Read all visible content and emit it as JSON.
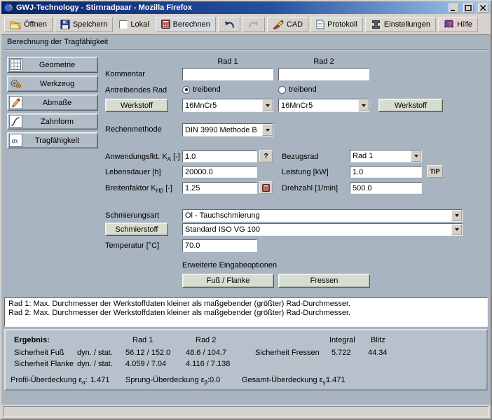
{
  "window": {
    "title": "GWJ-Technology - Stirnradpaar - Mozilla Firefox"
  },
  "toolbar": {
    "open": "Öffnen",
    "save": "Speichern",
    "local": "Lokal",
    "calculate": "Berechnen",
    "cad": "CAD",
    "protocol": "Protokoll",
    "settings": "Einstellungen",
    "help": "Hilfe"
  },
  "header": {
    "title": "Berechnung der Tragfähigkeit"
  },
  "sidebar": {
    "items": [
      {
        "label": "Geometrie"
      },
      {
        "label": "Werkzeug"
      },
      {
        "label": "Abmaße"
      },
      {
        "label": "Zahnform"
      },
      {
        "label": "Tragfähigkeit"
      }
    ]
  },
  "icons": {
    "sigma_glyph": "σx",
    "help_glyph": "?"
  },
  "form": {
    "col1_header": "Rad 1",
    "col2_header": "Rad 2",
    "comment_label": "Kommentar",
    "comment1": "",
    "comment2": "",
    "driving_label": "Antreibendes Rad",
    "radio1_label": "treibend",
    "radio2_label": "treibend",
    "material_button_left": "Werkstoff",
    "material_button_right": "Werkstoff",
    "material1": "16MnCr5",
    "material2": "16MnCr5",
    "method_label": "Rechenmethode",
    "method_value": "DIN 3990 Methode B",
    "ka_label": {
      "pre": "Anwendungsfkt. K",
      "sub": "A",
      "post": " [-]"
    },
    "ka_value": "1.0",
    "help_button": "?",
    "bezugsrad_label": "Bezugsrad",
    "bezugsrad_value": "Rad 1",
    "lebensdauer_label": "Lebensdauer [h]",
    "lebensdauer_value": "20000.0",
    "leistung_label": "Leistung [kW]",
    "leistung_value": "1.0",
    "tp_button": "T/P",
    "khb_label": {
      "pre": "Breitenfaktor K",
      "sub": "Hβ",
      "post": " [-]"
    },
    "khb_value": "1.25",
    "drehzahl_label": "Drehzahl [1/min]",
    "drehzahl_value": "500.0",
    "schmierungsart_label": "Schmierungsart",
    "schmierungsart_value": "Öl - Tauchschmierung",
    "schmierstoff_button": "Schmierstoff",
    "schmierstoff_value": "Standard ISO VG 100",
    "temperatur_label": "Temperatur [°C]",
    "temperatur_value": "70.0",
    "advanced_label": "Erweiterte Eingabeoptionen",
    "fuss_flanke_button": "Fuß / Flanke",
    "fressen_button": "Fressen"
  },
  "messages": {
    "lines": [
      "Rad 1: Max. Durchmesser der Werkstoffdaten kleiner als maßgebender (größter) Rad-Durchmesser.",
      "Rad 2: Max. Durchmesser der Werkstoffdaten kleiner als maßgebender (größter) Rad-Durchmesser."
    ]
  },
  "results": {
    "title": "Ergebnis:",
    "col_rad1": "Rad 1",
    "col_rad2": "Rad 2",
    "col_integral": "Integral",
    "col_blitz": "Blitz",
    "fuss_label": "Sicherheit Fuß",
    "fuss_mode": "dyn. / stat.",
    "fuss_rad1": "56.12 / 152.0",
    "fuss_rad2": "48.6  / 104.7",
    "flanke_label": "Sicherheit Flanke",
    "flanke_mode": "dyn. / stat.",
    "flanke_rad1": "4.059 / 7.04",
    "flanke_rad2": "4.116 / 7.138",
    "fressen_label": "Sicherheit Fressen",
    "fressen_integral": "5.722",
    "fressen_blitz": "44.34",
    "profil_label": {
      "pre": "Profil-Überdeckung ε",
      "sub": "α",
      "post": ":"
    },
    "profil_value": "1.471",
    "sprung_label": {
      "pre": "Sprung-Überdeckung ε",
      "sub": "β",
      "post": ":"
    },
    "sprung_value": "0.0",
    "gesamt_label": {
      "pre": "Gesamt-Überdeckung ε",
      "sub": "γ",
      "post": ":"
    },
    "gesamt_value": "1.471"
  },
  "colors": {
    "titlebar_start": "#0a246a",
    "titlebar_end": "#a6caf0",
    "main_bg": "#a8b4bf",
    "panel_bg": "#b6c1cb",
    "toolbar_bg": "#d6d3ce",
    "button_green": "#d7ddd1",
    "field_bg": "#ffffff"
  }
}
